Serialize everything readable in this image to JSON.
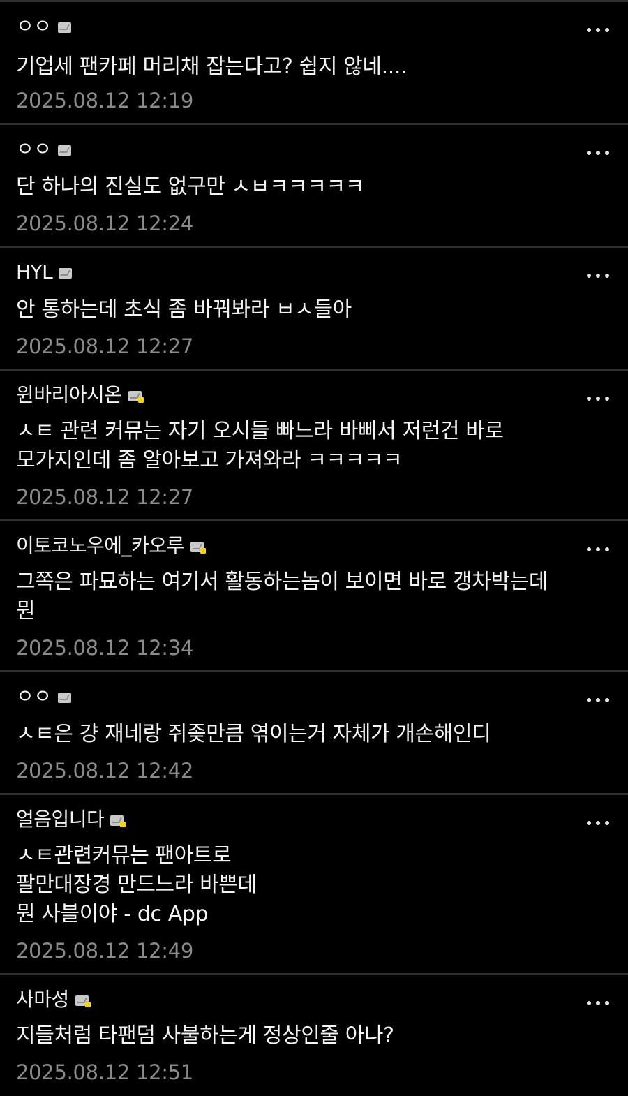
{
  "comments": [
    {
      "nickname": "ㅇㅇ",
      "badge": "gallery-icon",
      "text": "기업세 팬카페 머리채 잡는다고? 쉽지 않네....",
      "time": "2025.08.12 12:19"
    },
    {
      "nickname": "ㅇㅇ",
      "badge": "gallery-icon",
      "text": "단 하나의 진실도 없구만 ㅅㅂㅋㅋㅋㅋㅋ",
      "time": "2025.08.12 12:24"
    },
    {
      "nickname": "HYL",
      "badge": "gallery-icon",
      "text": "안 통하는데 초식 좀 바꿔봐라 ㅂㅅ들아",
      "time": "2025.08.12 12:27"
    },
    {
      "nickname": "윈바리아시온",
      "badge": "fixed-nick-icon",
      "text": "ㅅㅌ 관련 커뮤는 자기 오시들 빠느라 바삐서 저런건 바로\n모가지인데 좀 알아보고 가져와라 ㅋㅋㅋㅋㅋ",
      "time": "2025.08.12 12:27"
    },
    {
      "nickname": "이토코노우에_카오루",
      "badge": "fixed-nick-icon",
      "text": "그쪽은 파묘하는 여기서 활동하는놈이 보이면 바로 갱차박는데\n뭔",
      "time": "2025.08.12 12:34"
    },
    {
      "nickname": "ㅇㅇ",
      "badge": "gallery-icon",
      "text": "ㅅㅌ은 걍 재네랑 쥐좆만큼 엮이는거 자체가 개손해인디",
      "time": "2025.08.12 12:42"
    },
    {
      "nickname": "얼음입니다",
      "badge": "fixed-nick-icon",
      "text": "ㅅㅌ관련커뮤는 팬아트로\n팔만대장경 만드느라 바쁜데\n뭔 사블이야 - dc App",
      "time": "2025.08.12 12:49"
    },
    {
      "nickname": "사마성",
      "badge": "fixed-nick-icon",
      "text": "지들처럼 타팬덤 사불하는게 정상인줄 아나?",
      "time": "2025.08.12 12:51"
    }
  ],
  "more_icon": "more-vertical-dots-icon",
  "colors": {
    "background": "#000000",
    "divider": "#2e2e2e",
    "text": "#f4f4f4",
    "timestamp": "#8a8a8a",
    "fixed_badge_accent": "#f5d21a"
  }
}
